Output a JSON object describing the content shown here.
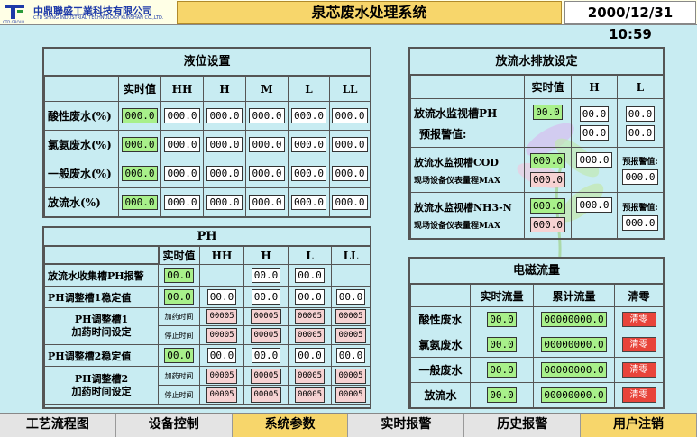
{
  "header": {
    "company_cn": "中鼎聯盛工業科技有限公司",
    "company_en": "CTD SHING INDUSTRIAL TECHNOLOGY KUNSHAN CO.,LTD.",
    "group": "CTD GROUP",
    "title": "泉芯废水处理系统",
    "datetime": "2000/12/31 10:59"
  },
  "level": {
    "title": "液位设置",
    "columns": [
      "实时值",
      "HH",
      "H",
      "M",
      "L",
      "LL"
    ],
    "rows": [
      {
        "label": "酸性废水(%)",
        "values": [
          "000.0",
          "000.0",
          "000.0",
          "000.0",
          "000.0",
          "000.0"
        ]
      },
      {
        "label": "氯氨废水(%)",
        "values": [
          "000.0",
          "000.0",
          "000.0",
          "000.0",
          "000.0",
          "000.0"
        ]
      },
      {
        "label": "一般废水(%)",
        "values": [
          "000.0",
          "000.0",
          "000.0",
          "000.0",
          "000.0",
          "000.0"
        ]
      },
      {
        "label": "放流水(%)",
        "values": [
          "000.0",
          "000.0",
          "000.0",
          "000.0",
          "000.0",
          "000.0"
        ]
      }
    ]
  },
  "ph": {
    "title": "PH",
    "columns": [
      "实时值",
      "HH",
      "H",
      "L",
      "LL"
    ],
    "alarm_label": "放流水收集槽PH报警",
    "alarm_rt": "00.0",
    "alarm_h": "00.0",
    "alarm_l": "00.0",
    "t1_label": "PH调整槽1稳定值",
    "t1_values": [
      "00.0",
      "00.0",
      "00.0",
      "00.0",
      "00.0"
    ],
    "t1_dose_label": "PH调整槽1\n加药时间设定",
    "t2_label": "PH调整槽2稳定值",
    "t2_values": [
      "00.0",
      "00.0",
      "00.0",
      "00.0",
      "00.0"
    ],
    "t2_dose_label": "PH调整槽2\n加药时间设定",
    "add_time": "加药时间",
    "stop_time": "停止时间",
    "timer_value": "00005"
  },
  "discharge": {
    "title": "放流水排放设定",
    "columns": [
      "实时值",
      "H",
      "L"
    ],
    "ph_label": "放流水监视槽PH",
    "ph_warn": "预报警值:",
    "ph_rt": "00.0",
    "ph_h": "00.0",
    "ph_l": "00.0",
    "ph_h2": "00.0",
    "ph_l2": "00.0",
    "cod_label": "放流水监视槽COD",
    "cod_range": "现场设备仪表量程MAX",
    "cod_rt": "000.0",
    "cod_h": "000.0",
    "cod_warn": "预报警值:",
    "cod_max": "000.0",
    "cod_warnval": "000.0",
    "nh3_label": "放流水监视槽NH3-N",
    "nh3_range": "现场设备仪表量程MAX",
    "nh3_rt": "000.0",
    "nh3_h": "000.0",
    "nh3_warn": "预报警值:",
    "nh3_max": "000.0",
    "nh3_warnval": "000.0"
  },
  "flow": {
    "title": "电磁流量",
    "columns": [
      "实时流量",
      "累计流量",
      "清零"
    ],
    "rows": [
      {
        "label": "酸性废水",
        "rt": "00.0",
        "total": "00000000.0",
        "btn": "清零"
      },
      {
        "label": "氯氨废水",
        "rt": "00.0",
        "total": "00000000.0",
        "btn": "清零"
      },
      {
        "label": "一般废水",
        "rt": "00.0",
        "total": "00000000.0",
        "btn": "清零"
      },
      {
        "label": "放流水",
        "rt": "00.0",
        "total": "00000000.0",
        "btn": "清零"
      }
    ]
  },
  "nav": [
    "工艺流程图",
    "设备控制",
    "系统参数",
    "实时报警",
    "历史报警",
    "用户注销"
  ]
}
